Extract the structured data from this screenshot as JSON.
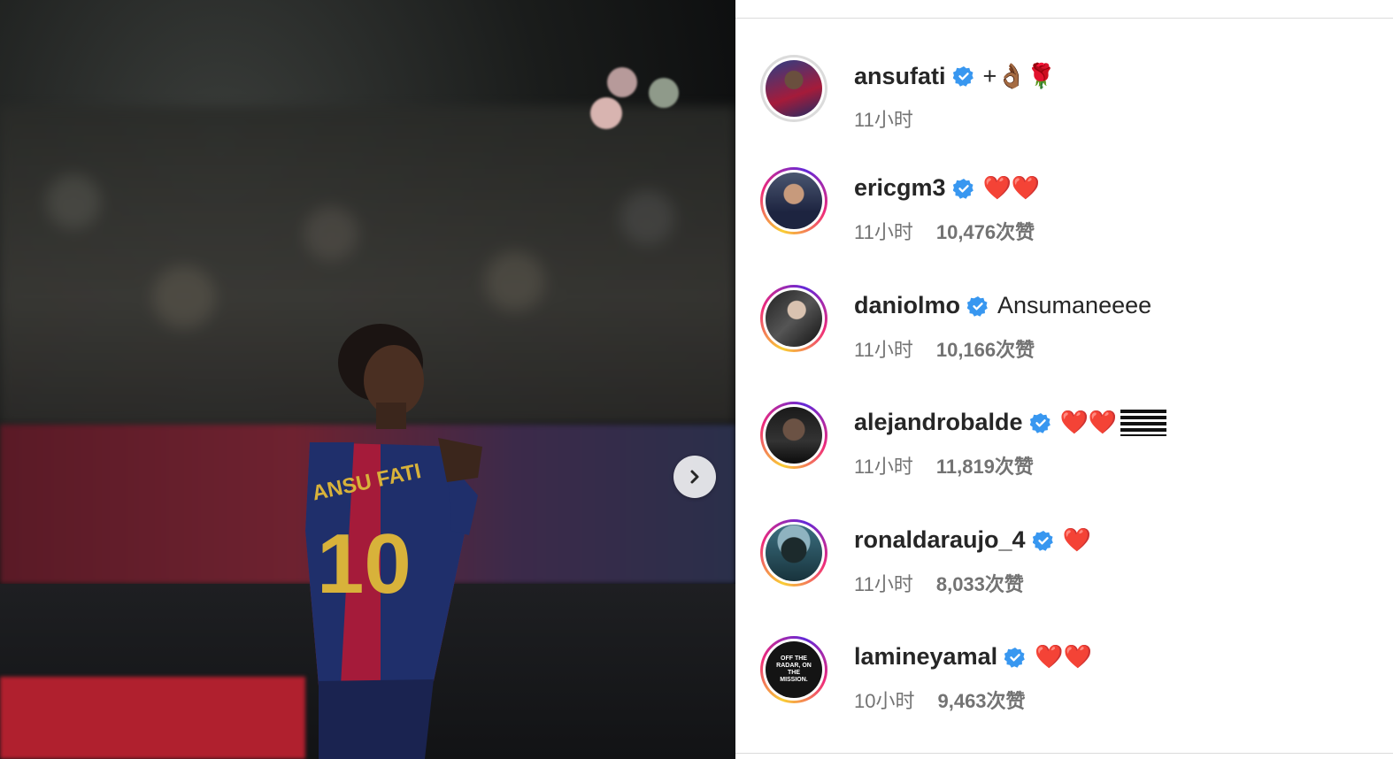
{
  "photo": {
    "alt_jersey_name": "ANSU FATI",
    "jersey_number": "10"
  },
  "carousel": {
    "next_icon": "chevron-right-icon"
  },
  "comments": [
    {
      "username": "ansufati",
      "verified": true,
      "text": "+👌🏾🌹",
      "time": "11小时",
      "likes": "",
      "ring": "plain"
    },
    {
      "username": "ericgm3",
      "verified": true,
      "text": "❤️❤️",
      "time": "11小时",
      "likes": "10,476次赞",
      "ring": "story"
    },
    {
      "username": "daniolmo",
      "verified": true,
      "text": "Ansumaneeee",
      "time": "11小时",
      "likes": "10,166次赞",
      "ring": "story"
    },
    {
      "username": "alejandrobalde",
      "verified": true,
      "text": "❤️❤️",
      "time": "11小时",
      "likes": "11,819次赞",
      "ring": "story"
    },
    {
      "username": "ronaldaraujo_4",
      "verified": true,
      "text": "❤️",
      "time": "11小时",
      "likes": "8,033次赞",
      "ring": "story"
    },
    {
      "username": "lamineyamal",
      "verified": true,
      "text": "❤️❤️",
      "time": "10小时",
      "likes": "9,463次赞",
      "ring": "story"
    }
  ],
  "avatar_text": {
    "lamineyamal": "OFF THE RADAR, ON THE MISSION."
  },
  "colors": {
    "verified": "#3897f0",
    "accent_red": "#b0202e"
  }
}
